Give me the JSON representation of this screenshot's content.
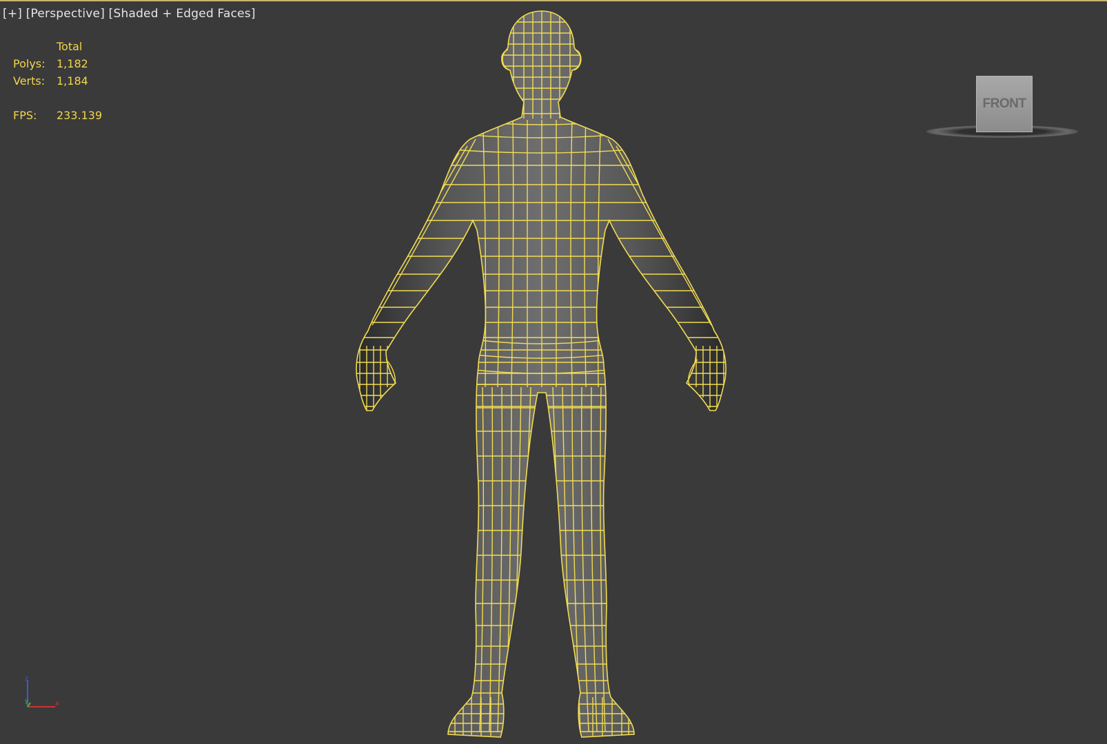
{
  "viewport": {
    "menu_plus": "[+]",
    "menu_view": "[Perspective]",
    "menu_shading": "[Shaded + Edged Faces]"
  },
  "stats": {
    "header": "Total",
    "polys_label": "Polys:",
    "polys_value": "1,182",
    "verts_label": "Verts:",
    "verts_value": "1,184",
    "fps_label": "FPS:",
    "fps_value": "233.139"
  },
  "viewcube": {
    "face_label": "FRONT"
  },
  "gizmo": {
    "z": "z",
    "x": "x",
    "y": "y"
  },
  "colors": {
    "background": "#3a3a3a",
    "wire": "#f2dc52",
    "stats_text": "#f3d64a",
    "axis_x": "#d23232",
    "axis_y": "#36c036",
    "axis_z": "#3a5bd8"
  },
  "icons": {
    "axis": "axis-tripod-icon",
    "viewcube": "viewcube-icon"
  }
}
